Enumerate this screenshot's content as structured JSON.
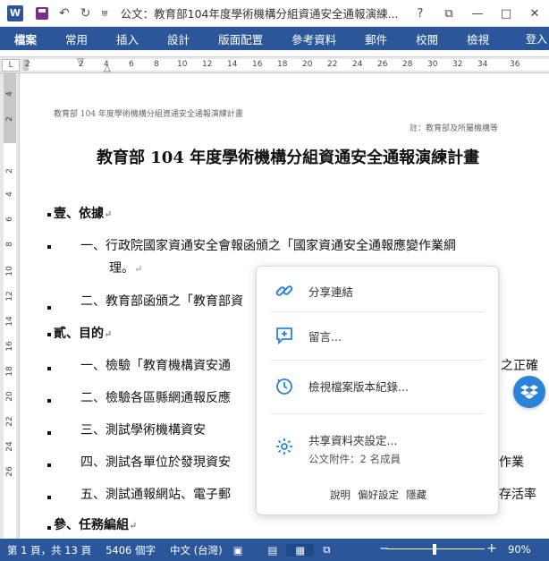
{
  "titlebar": {
    "app_logo": "W",
    "title": "公文：教育部104年度學術機構分組資通安全通報演練...",
    "help": "?",
    "restore_ribbon": "⧉",
    "minimize": "—",
    "maximize": "□",
    "close": "✕",
    "undo_icon": "↶",
    "redo_icon": "↻",
    "qat_dropdown": "⩐"
  },
  "ribbon": {
    "tabs": [
      "檔案",
      "常用",
      "插入",
      "設計",
      "版面配置",
      "參考資料",
      "郵件",
      "校閱",
      "檢視"
    ],
    "login": "登入"
  },
  "ruler": {
    "corner": "L",
    "h_numbers": [
      "2",
      "2",
      "4",
      "6",
      "8",
      "10",
      "12",
      "14",
      "16",
      "18",
      "20",
      "22",
      "24",
      "26",
      "28",
      "30",
      "32",
      "34",
      "36"
    ],
    "v_numbers": [
      "4",
      "2",
      "2",
      "4",
      "6",
      "8",
      "10",
      "12",
      "14",
      "16",
      "18",
      "20",
      "22",
      "24",
      "26"
    ]
  },
  "document": {
    "header_left": "教育部 104 年度學術機構分組資通安全通報演練計畫",
    "header_right": "註：教育部及所屬機構等",
    "title": "教育部 104 年度學術機構分組資通安全通報演練計畫",
    "sec1": "壹、依據",
    "l1a": "一、行政院國家資通安全會報函頒之「國家資通安全通報應變作業綱",
    "l1b": "理。",
    "l2": "二、教育部函頒之「教育部資",
    "sec2": "貳、目的",
    "l3": "一、檢驗「教育機構資安通",
    "l3tail": "之正確",
    "l4": "二、檢驗各區縣網通報反應",
    "l5": "三、測試學術機構資安",
    "l6": "四、測試各單位於發現資安",
    "l6tail": "作業",
    "l7": "五、測試通報網站、電子郵",
    "l7tail": "存活率",
    "sec3": "參、任務編組",
    "para_mark": "↵"
  },
  "popup": {
    "share_link": "分享連結",
    "comment": "留言...",
    "version_history": "檢視檔案版本紀錄...",
    "shared_folder": "共享資料夾設定...",
    "shared_members": "公文附件：2 名成員",
    "footer_help": "說明",
    "footer_prefs": "偏好設定",
    "footer_hide": "隱藏"
  },
  "status": {
    "page": "第 1 頁，共 13 頁",
    "words": "5406 個字",
    "language": "中文 (台灣)",
    "zoom_minus": "−",
    "zoom_plus": "+",
    "zoom": "90%"
  }
}
